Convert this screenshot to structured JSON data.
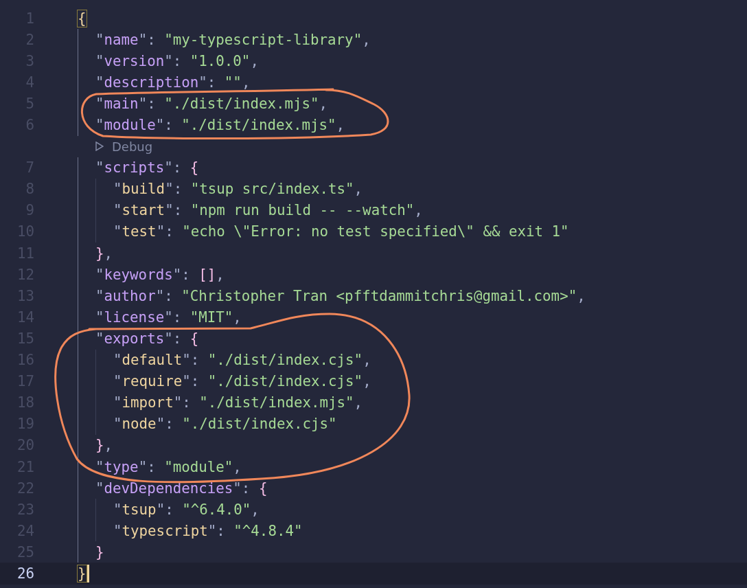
{
  "editor": {
    "lines": [
      {
        "kind": "code",
        "number": "1",
        "current": false,
        "tokens": [
          {
            "kind": "match",
            "text": "{"
          }
        ],
        "children": [
          {
            "kind": "code",
            "number": "2",
            "current": false,
            "tokens": [
              {
                "kind": "punct",
                "text": "\""
              },
              {
                "kind": "key",
                "text": "name"
              },
              {
                "kind": "punct",
                "text": "\": "
              },
              {
                "kind": "string",
                "text": "\"my-typescript-library\""
              },
              {
                "kind": "punct",
                "text": ","
              }
            ]
          },
          {
            "kind": "code",
            "number": "3",
            "current": false,
            "tokens": [
              {
                "kind": "punct",
                "text": "\""
              },
              {
                "kind": "key",
                "text": "version"
              },
              {
                "kind": "punct",
                "text": "\": "
              },
              {
                "kind": "string",
                "text": "\"1.0.0\""
              },
              {
                "kind": "punct",
                "text": ","
              }
            ]
          },
          {
            "kind": "code",
            "number": "4",
            "current": false,
            "tokens": [
              {
                "kind": "punct",
                "text": "\""
              },
              {
                "kind": "key",
                "text": "description"
              },
              {
                "kind": "punct",
                "text": "\": "
              },
              {
                "kind": "string",
                "text": "\"\""
              },
              {
                "kind": "punct",
                "text": ","
              }
            ]
          },
          {
            "kind": "code",
            "number": "5",
            "current": false,
            "tokens": [
              {
                "kind": "punct",
                "text": "\""
              },
              {
                "kind": "key",
                "text": "main"
              },
              {
                "kind": "punct",
                "text": "\": "
              },
              {
                "kind": "string",
                "text": "\"./dist/index.mjs\""
              },
              {
                "kind": "punct",
                "text": ","
              }
            ]
          },
          {
            "kind": "code",
            "number": "6",
            "current": false,
            "tokens": [
              {
                "kind": "punct",
                "text": "\""
              },
              {
                "kind": "key",
                "text": "module"
              },
              {
                "kind": "punct",
                "text": "\": "
              },
              {
                "kind": "string",
                "text": "\"./dist/index.mjs\""
              },
              {
                "kind": "punct",
                "text": ","
              }
            ]
          },
          {
            "kind": "codelens",
            "text": "Debug"
          },
          {
            "kind": "code",
            "number": "7",
            "current": false,
            "tokens": [
              {
                "kind": "punct",
                "text": "\""
              },
              {
                "kind": "key",
                "text": "scripts"
              },
              {
                "kind": "punct",
                "text": "\": "
              },
              {
                "kind": "brace",
                "text": "{"
              }
            ],
            "children": [
              {
                "kind": "code",
                "number": "8",
                "current": false,
                "tokens": [
                  {
                    "kind": "punct",
                    "text": "\""
                  },
                  {
                    "kind": "key",
                    "text": "build"
                  },
                  {
                    "kind": "punct",
                    "text": "\": "
                  },
                  {
                    "kind": "string",
                    "text": "\"tsup src/index.ts\""
                  },
                  {
                    "kind": "punct",
                    "text": ","
                  }
                ]
              },
              {
                "kind": "code",
                "number": "9",
                "current": false,
                "tokens": [
                  {
                    "kind": "punct",
                    "text": "\""
                  },
                  {
                    "kind": "key",
                    "text": "start"
                  },
                  {
                    "kind": "punct",
                    "text": "\": "
                  },
                  {
                    "kind": "string",
                    "text": "\"npm run build -- --watch\""
                  },
                  {
                    "kind": "punct",
                    "text": ","
                  }
                ]
              },
              {
                "kind": "code",
                "number": "10",
                "current": false,
                "tokens": [
                  {
                    "kind": "punct",
                    "text": "\""
                  },
                  {
                    "kind": "key",
                    "text": "test"
                  },
                  {
                    "kind": "punct",
                    "text": "\": "
                  },
                  {
                    "kind": "string",
                    "text": "\"echo \\\"Error: no test specified\\\" && exit 1\""
                  }
                ]
              }
            ]
          },
          {
            "kind": "code",
            "number": "11",
            "current": false,
            "tokens": [
              {
                "kind": "brace",
                "text": "}"
              },
              {
                "kind": "punct",
                "text": ","
              }
            ]
          },
          {
            "kind": "code",
            "number": "12",
            "current": false,
            "tokens": [
              {
                "kind": "punct",
                "text": "\""
              },
              {
                "kind": "key",
                "text": "keywords"
              },
              {
                "kind": "punct",
                "text": "\": "
              },
              {
                "kind": "brace",
                "text": "[]"
              },
              {
                "kind": "punct",
                "text": ","
              }
            ]
          },
          {
            "kind": "code",
            "number": "13",
            "current": false,
            "tokens": [
              {
                "kind": "punct",
                "text": "\""
              },
              {
                "kind": "key",
                "text": "author"
              },
              {
                "kind": "punct",
                "text": "\": "
              },
              {
                "kind": "string",
                "text": "\"Christopher Tran <pfftdammitchris@gmail.com>\""
              },
              {
                "kind": "punct",
                "text": ","
              }
            ]
          },
          {
            "kind": "code",
            "number": "14",
            "current": false,
            "tokens": [
              {
                "kind": "punct",
                "text": "\""
              },
              {
                "kind": "key",
                "text": "license"
              },
              {
                "kind": "punct",
                "text": "\": "
              },
              {
                "kind": "string",
                "text": "\"MIT\""
              },
              {
                "kind": "punct",
                "text": ","
              }
            ]
          },
          {
            "kind": "code",
            "number": "15",
            "current": false,
            "tokens": [
              {
                "kind": "punct",
                "text": "\""
              },
              {
                "kind": "key",
                "text": "exports"
              },
              {
                "kind": "punct",
                "text": "\": "
              },
              {
                "kind": "brace",
                "text": "{"
              }
            ],
            "children": [
              {
                "kind": "code",
                "number": "16",
                "current": false,
                "tokens": [
                  {
                    "kind": "punct",
                    "text": "\""
                  },
                  {
                    "kind": "key",
                    "text": "default"
                  },
                  {
                    "kind": "punct",
                    "text": "\": "
                  },
                  {
                    "kind": "string",
                    "text": "\"./dist/index.cjs\""
                  },
                  {
                    "kind": "punct",
                    "text": ","
                  }
                ]
              },
              {
                "kind": "code",
                "number": "17",
                "current": false,
                "tokens": [
                  {
                    "kind": "punct",
                    "text": "\""
                  },
                  {
                    "kind": "key",
                    "text": "require"
                  },
                  {
                    "kind": "punct",
                    "text": "\": "
                  },
                  {
                    "kind": "string",
                    "text": "\"./dist/index.cjs\""
                  },
                  {
                    "kind": "punct",
                    "text": ","
                  }
                ]
              },
              {
                "kind": "code",
                "number": "18",
                "current": false,
                "tokens": [
                  {
                    "kind": "punct",
                    "text": "\""
                  },
                  {
                    "kind": "key",
                    "text": "import"
                  },
                  {
                    "kind": "punct",
                    "text": "\": "
                  },
                  {
                    "kind": "string",
                    "text": "\"./dist/index.mjs\""
                  },
                  {
                    "kind": "punct",
                    "text": ","
                  }
                ]
              },
              {
                "kind": "code",
                "number": "19",
                "current": false,
                "tokens": [
                  {
                    "kind": "punct",
                    "text": "\""
                  },
                  {
                    "kind": "key",
                    "text": "node"
                  },
                  {
                    "kind": "punct",
                    "text": "\": "
                  },
                  {
                    "kind": "string",
                    "text": "\"./dist/index.cjs\""
                  }
                ]
              }
            ]
          },
          {
            "kind": "code",
            "number": "20",
            "current": false,
            "tokens": [
              {
                "kind": "brace",
                "text": "}"
              },
              {
                "kind": "punct",
                "text": ","
              }
            ]
          },
          {
            "kind": "code",
            "number": "21",
            "current": false,
            "tokens": [
              {
                "kind": "punct",
                "text": "\""
              },
              {
                "kind": "key",
                "text": "type"
              },
              {
                "kind": "punct",
                "text": "\": "
              },
              {
                "kind": "string",
                "text": "\"module\""
              },
              {
                "kind": "punct",
                "text": ","
              }
            ]
          },
          {
            "kind": "code",
            "number": "22",
            "current": false,
            "tokens": [
              {
                "kind": "punct",
                "text": "\""
              },
              {
                "kind": "key",
                "text": "devDependencies"
              },
              {
                "kind": "punct",
                "text": "\": "
              },
              {
                "kind": "brace",
                "text": "{"
              }
            ],
            "children": [
              {
                "kind": "code",
                "number": "23",
                "current": false,
                "tokens": [
                  {
                    "kind": "punct",
                    "text": "\""
                  },
                  {
                    "kind": "key",
                    "text": "tsup"
                  },
                  {
                    "kind": "punct",
                    "text": "\": "
                  },
                  {
                    "kind": "string",
                    "text": "\"^6.4.0\""
                  },
                  {
                    "kind": "punct",
                    "text": ","
                  }
                ]
              },
              {
                "kind": "code",
                "number": "24",
                "current": false,
                "tokens": [
                  {
                    "kind": "punct",
                    "text": "\""
                  },
                  {
                    "kind": "key",
                    "text": "typescript"
                  },
                  {
                    "kind": "punct",
                    "text": "\": "
                  },
                  {
                    "kind": "string",
                    "text": "\"^4.8.4\""
                  }
                ]
              }
            ]
          },
          {
            "kind": "code",
            "number": "25",
            "current": false,
            "tokens": [
              {
                "kind": "brace",
                "text": "}"
              }
            ]
          }
        ]
      },
      {
        "kind": "code",
        "number": "26",
        "current": true,
        "tokens": [
          {
            "kind": "match",
            "text": "}"
          }
        ]
      }
    ]
  },
  "annotations": [
    {
      "kind": "loop"
    },
    {
      "kind": "loop"
    }
  ]
}
